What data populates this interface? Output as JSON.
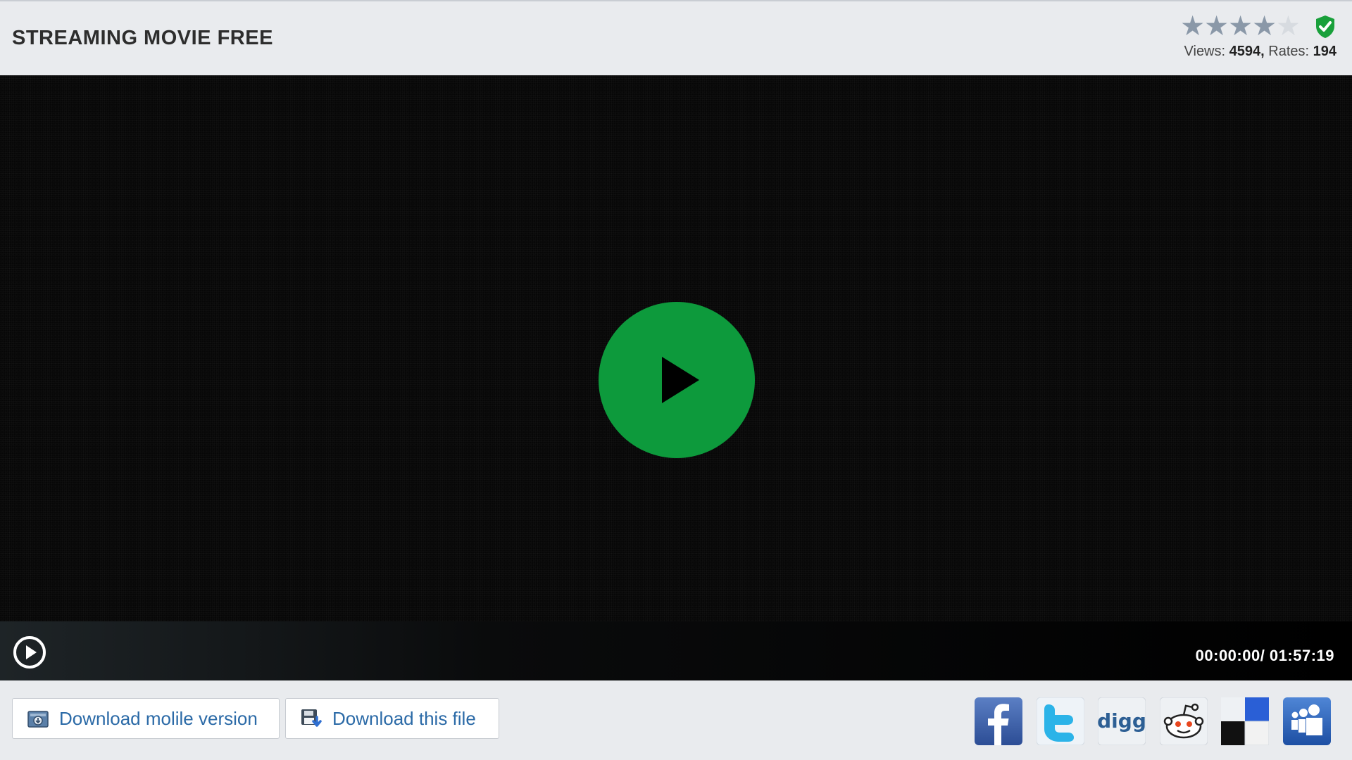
{
  "header": {
    "title": "STREAMING MOVIE FREE",
    "rating": {
      "value": 4,
      "max": 5
    },
    "stats": {
      "views_label": "Views:",
      "views": "4594,",
      "rates_label": "Rates:",
      "rates": "194"
    }
  },
  "player": {
    "time": "00:00:00/ 01:57:19",
    "accent_color": "#0d9a3c"
  },
  "footer": {
    "download_mobile_label": "Download molile version",
    "download_file_label": "Download this file",
    "social": [
      "facebook-icon",
      "twitter-icon",
      "digg-icon",
      "reddit-icon",
      "delicious-icon",
      "myspace-icon"
    ],
    "digg_text": "digg"
  }
}
